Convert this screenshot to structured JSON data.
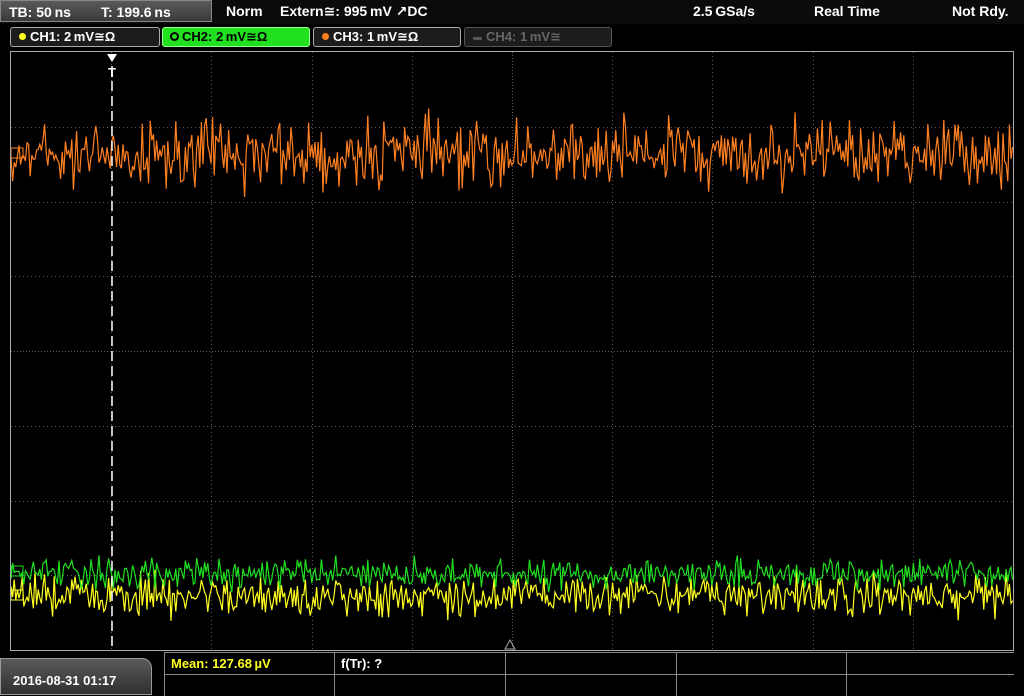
{
  "topbar": {
    "timebase": "TB: 50 ns",
    "trigger_time": "T: 199.6 ns",
    "mode": "Norm",
    "trigger_source": "Extern≅: 995 mV ↗DC",
    "sample_rate": "2.5 GSa/s",
    "acq_mode": "Real Time",
    "status": "Not Rdy."
  },
  "channels": [
    {
      "label": "CH1: 2 mV≅Ω",
      "color": "#ffff20",
      "state": "on"
    },
    {
      "label": "CH2: 2 mV≅Ω",
      "color": "#20e020",
      "state": "active"
    },
    {
      "label": "CH3: 1 mV≅Ω",
      "color": "#ff8020",
      "state": "on"
    },
    {
      "label": "CH4: 1 mV≅",
      "color": "#666666",
      "state": "off"
    }
  ],
  "trigger_marker": "T",
  "datetime": "2016-08-31 01:17",
  "measurements": {
    "mean": "Mean: 127.68 µV",
    "ftr": "f(Tr): ?"
  },
  "colors": {
    "ch1": "#ffff20",
    "ch2": "#20e020",
    "ch3": "#ff8020",
    "grid": "#5a5a5a"
  }
}
